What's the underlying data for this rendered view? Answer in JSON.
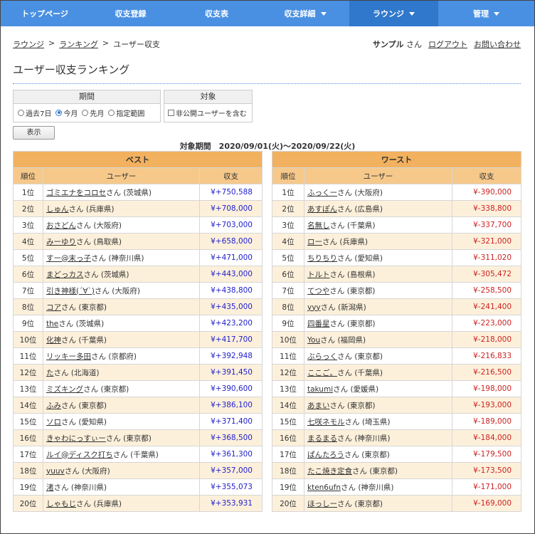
{
  "nav": [
    {
      "label": "トップページ",
      "caret": false,
      "active": false,
      "width": 124
    },
    {
      "label": "収支登録",
      "caret": false,
      "active": false,
      "width": 117
    },
    {
      "label": "収支表",
      "caret": false,
      "active": false,
      "width": 125
    },
    {
      "label": "収支詳細",
      "caret": true,
      "active": false,
      "width": 124
    },
    {
      "label": "ラウンジ",
      "caret": true,
      "active": true,
      "width": 125
    },
    {
      "label": "管理",
      "caret": true,
      "active": false,
      "width": 135
    }
  ],
  "breadcrumb": {
    "lounge": "ラウンジ",
    "sep1": ">",
    "ranking": "ランキング",
    "sep2": ">",
    "current": "ユーザー収支"
  },
  "user": {
    "name": "サンプル",
    "suffix": "さん",
    "logout": "ログアウト",
    "contact": "お問い合わせ"
  },
  "title": "ユーザー収支ランキング",
  "filters": {
    "period_label": "期間",
    "period_options": [
      {
        "label": "過去7日",
        "checked": false
      },
      {
        "label": "今月",
        "checked": true
      },
      {
        "label": "先月",
        "checked": false
      },
      {
        "label": "指定範囲",
        "checked": false
      }
    ],
    "target_label": "対象",
    "include_private": "非公開ユーザーを含む",
    "show_button": "表示"
  },
  "period_text": "対象期間　2020/09/01(火)～2020/09/22(火)",
  "best": {
    "caption": "ベスト",
    "col_rank": "順位",
    "col_user": "ユーザー",
    "col_amount": "収支",
    "rows": [
      {
        "rank": "1位",
        "name": "ゴミエナをコロセ",
        "pref": "さん (茨城県)",
        "amount": "¥+750,588"
      },
      {
        "rank": "2位",
        "name": "しゅん",
        "pref": "さん (兵庫県)",
        "amount": "¥+708,000"
      },
      {
        "rank": "3位",
        "name": "おさどん",
        "pref": "さん (大阪府)",
        "amount": "¥+703,000"
      },
      {
        "rank": "4位",
        "name": "みーゆり",
        "pref": "さん (鳥取県)",
        "amount": "¥+658,000"
      },
      {
        "rank": "5位",
        "name": "すー@末っ子",
        "pref": "さん (神奈川県)",
        "amount": "¥+471,000"
      },
      {
        "rank": "6位",
        "name": "まどっカス",
        "pref": "さん (茨城県)",
        "amount": "¥+443,000"
      },
      {
        "rank": "7位",
        "name": "引き神様(´∀`)",
        "pref": "さん (大阪府)",
        "amount": "¥+438,800"
      },
      {
        "rank": "8位",
        "name": "コア",
        "pref": "さん (東京都)",
        "amount": "¥+435,000"
      },
      {
        "rank": "9位",
        "name": "the",
        "pref": "さん (茨城県)",
        "amount": "¥+423,200"
      },
      {
        "rank": "10位",
        "name": "化神",
        "pref": "さん (千葉県)",
        "amount": "¥+417,700"
      },
      {
        "rank": "11位",
        "name": "リッキー多田",
        "pref": "さん (京都府)",
        "amount": "¥+392,948"
      },
      {
        "rank": "12位",
        "name": "た",
        "pref": "さん (北海道)",
        "amount": "¥+391,450"
      },
      {
        "rank": "13位",
        "name": "ミズキング",
        "pref": "さん (東京都)",
        "amount": "¥+390,600"
      },
      {
        "rank": "14位",
        "name": "ふみ",
        "pref": "さん (東京都)",
        "amount": "¥+386,100"
      },
      {
        "rank": "15位",
        "name": "ソロ",
        "pref": "さん (愛知県)",
        "amount": "¥+371,400"
      },
      {
        "rank": "16位",
        "name": "きゃわにっすぃー",
        "pref": "さん (東京都)",
        "amount": "¥+368,500"
      },
      {
        "rank": "17位",
        "name": "ルイ@ディスク打ち",
        "pref": "さん (千葉県)",
        "amount": "¥+361,300"
      },
      {
        "rank": "18位",
        "name": "yuuv",
        "pref": "さん (大阪府)",
        "amount": "¥+357,000"
      },
      {
        "rank": "19位",
        "name": "渚",
        "pref": "さん (神奈川県)",
        "amount": "¥+355,073"
      },
      {
        "rank": "20位",
        "name": "しゃもじ",
        "pref": "さん (兵庫県)",
        "amount": "¥+353,931"
      }
    ]
  },
  "worst": {
    "caption": "ワースト",
    "col_rank": "順位",
    "col_user": "ユーザー",
    "col_amount": "収支",
    "rows": [
      {
        "rank": "1位",
        "name": "ふっくー",
        "pref": "さん (大阪府)",
        "amount": "¥-390,000"
      },
      {
        "rank": "2位",
        "name": "あすぽん",
        "pref": "さん (広島県)",
        "amount": "¥-338,800"
      },
      {
        "rank": "3位",
        "name": "名無し",
        "pref": "さん (千葉県)",
        "amount": "¥-337,700"
      },
      {
        "rank": "4位",
        "name": "ロー",
        "pref": "さん (兵庫県)",
        "amount": "¥-321,000"
      },
      {
        "rank": "5位",
        "name": "ちりちり",
        "pref": "さん (愛知県)",
        "amount": "¥-311,020"
      },
      {
        "rank": "6位",
        "name": "トルト",
        "pref": "さん (島根県)",
        "amount": "¥-305,472"
      },
      {
        "rank": "7位",
        "name": "てつや",
        "pref": "さん (東京都)",
        "amount": "¥-258,500"
      },
      {
        "rank": "8位",
        "name": "yyy",
        "pref": "さん (新潟県)",
        "amount": "¥-241,400"
      },
      {
        "rank": "9位",
        "name": "四番星",
        "pref": "さん (東京都)",
        "amount": "¥-223,000"
      },
      {
        "rank": "10位",
        "name": "You",
        "pref": "さん (福岡県)",
        "amount": "¥-218,000"
      },
      {
        "rank": "11位",
        "name": "ぶらっく",
        "pref": "さん (東京都)",
        "amount": "¥-216,833"
      },
      {
        "rank": "12位",
        "name": "ここご。",
        "pref": "さん (千葉県)",
        "amount": "¥-216,500"
      },
      {
        "rank": "13位",
        "name": "takumi",
        "pref": "さん (愛媛県)",
        "amount": "¥-198,000"
      },
      {
        "rank": "14位",
        "name": "あまい",
        "pref": "さん (東京都)",
        "amount": "¥-193,000"
      },
      {
        "rank": "15位",
        "name": "七咲ネモル",
        "pref": "さん (埼玉県)",
        "amount": "¥-189,000"
      },
      {
        "rank": "16位",
        "name": "まるまる",
        "pref": "さん (神奈川県)",
        "amount": "¥-184,000"
      },
      {
        "rank": "17位",
        "name": "ぱんたろう",
        "pref": "さん (東京都)",
        "amount": "¥-179,500"
      },
      {
        "rank": "18位",
        "name": "たこ焼き定食",
        "pref": "さん (東京都)",
        "amount": "¥-173,500"
      },
      {
        "rank": "19位",
        "name": "kten6ufn",
        "pref": "さん (神奈川県)",
        "amount": "¥-171,000"
      },
      {
        "rank": "20位",
        "name": "ほっしー",
        "pref": "さん (東京都)",
        "amount": "¥-169,000"
      }
    ]
  }
}
